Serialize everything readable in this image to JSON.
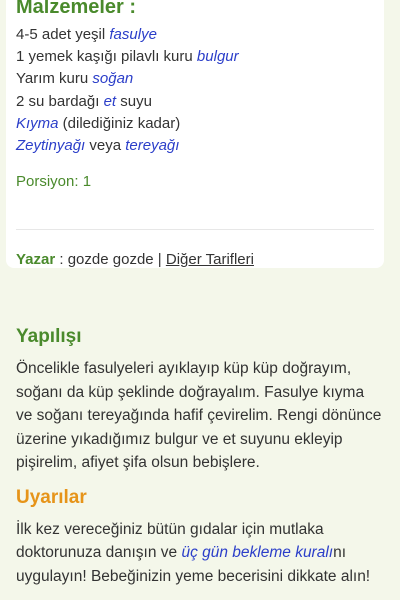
{
  "ingredients": {
    "title": "Malzemeler :",
    "items": [
      {
        "before": "4-5 adet yeşil ",
        "link": "fasulye",
        "after": ""
      },
      {
        "before": "1 yemek kaşığı pilavlı kuru ",
        "link": "bulgur",
        "after": ""
      },
      {
        "before": "Yarım kuru ",
        "link": "soğan",
        "after": ""
      },
      {
        "before": "2 su bardağı ",
        "link": "et",
        "after": " suyu"
      },
      {
        "before": "",
        "link": "Kıyma",
        "after": " (dilediğiniz kadar)"
      },
      {
        "before": "",
        "link": "Zeytinyağı",
        "middle": " veya ",
        "link2": "tereyağı",
        "after": ""
      }
    ],
    "portion": "Porsiyon: 1"
  },
  "author": {
    "label": "Yazar",
    "separator": " : ",
    "name": "gozde gozde",
    "pipe": " | ",
    "other_recipes": "Diğer Tarifleri"
  },
  "preparation": {
    "title": "Yapılışı",
    "text": "Öncelikle fasulyeleri ayıklayıp küp küp doğrayım, soğanı da küp şeklinde doğrayalım. Fasulye kıyma ve soğanı tereyağında hafif çevirelim. Rengi dönünce üzerine yıkadığımız bulgur ve et suyunu ekleyip pişirelim, afiyet şifa olsun bebişlere."
  },
  "warnings": {
    "title": "Uyarılar",
    "text_before": "İlk kez vereceğiniz bütün gıdalar için mutlaka doktorunuza danışın ve ",
    "link": "üç gün bekleme kuralı",
    "text_after": "nı uygulayın! Bebeğinizin yeme becerisini dikkate alın!"
  },
  "colors": {
    "green": "#4a8a2c",
    "orange": "#e69419",
    "link": "#2b3ec9",
    "background": "#f4f7ea"
  }
}
